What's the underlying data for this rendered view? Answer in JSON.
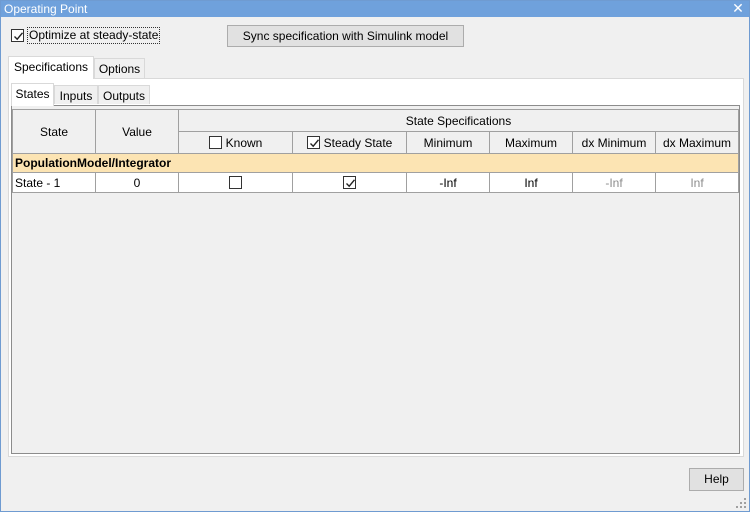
{
  "window": {
    "title": "Operating Point",
    "close_glyph": "✕"
  },
  "optimize": {
    "label": "Optimize at steady-state",
    "checked": true
  },
  "sync_button": "Sync specification with Simulink model",
  "tabs": [
    {
      "label": "Specifications",
      "active": true
    },
    {
      "label": "Options",
      "active": false
    }
  ],
  "subtabs": [
    {
      "label": "States",
      "active": true
    },
    {
      "label": "Inputs",
      "active": false
    },
    {
      "label": "Outputs",
      "active": false
    }
  ],
  "table": {
    "col_state": "State",
    "col_value": "Value",
    "group_header": "State Specifications",
    "col_known": "Known",
    "col_steady": "Steady State",
    "col_min": "Minimum",
    "col_max": "Maximum",
    "col_dxmin": "dx Minimum",
    "col_dxmax": "dx Maximum",
    "block": "PopulationModel/Integrator",
    "rows": [
      {
        "state": "State - 1",
        "value": "0",
        "known": false,
        "steady": true,
        "min": "-Inf",
        "max": "Inf",
        "dxmin": "-Inf",
        "dxmax": "Inf"
      }
    ]
  },
  "help_button": "Help",
  "colors": {
    "titlebar": "#6fa1dc",
    "group_row": "#fce4b3",
    "disabled_text": "#8c8c8c"
  }
}
